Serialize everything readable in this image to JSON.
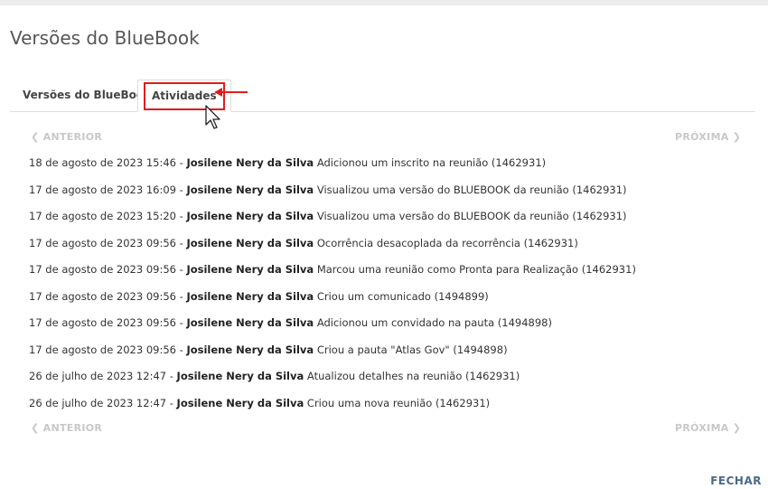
{
  "dialog": {
    "title": "Versões do BlueBook",
    "close_label": "FECHAR"
  },
  "tabs": [
    {
      "label": "Versões do BlueBook",
      "active": false
    },
    {
      "label": "Atividades",
      "active": true
    }
  ],
  "pager": {
    "prev_label": "ANTERIOR",
    "next_label": "PRÓXIMA"
  },
  "activities": [
    {
      "date": "18 de agosto de 2023 15:46 - ",
      "user": "Josilene Nery da Silva",
      "action": " Adicionou um inscrito na reunião (1462931)"
    },
    {
      "date": "17 de agosto de 2023 16:09 - ",
      "user": "Josilene Nery da Silva",
      "action": " Visualizou uma versão do BLUEBOOK da reunião (1462931)"
    },
    {
      "date": "17 de agosto de 2023 15:20 - ",
      "user": "Josilene Nery da Silva",
      "action": " Visualizou uma versão do BLUEBOOK da reunião (1462931)"
    },
    {
      "date": "17 de agosto de 2023 09:56 - ",
      "user": "Josilene Nery da Silva",
      "action": " Ocorrência desacoplada da recorrência (1462931)"
    },
    {
      "date": "17 de agosto de 2023 09:56 - ",
      "user": "Josilene Nery da Silva",
      "action": " Marcou uma reunião como Pronta para Realização (1462931)"
    },
    {
      "date": "17 de agosto de 2023 09:56 - ",
      "user": "Josilene Nery da Silva",
      "action": " Criou um comunicado (1494899)"
    },
    {
      "date": "17 de agosto de 2023 09:56 - ",
      "user": "Josilene Nery da Silva",
      "action": " Adicionou um convidado na pauta (1494898)"
    },
    {
      "date": "17 de agosto de 2023 09:56 - ",
      "user": "Josilene Nery da Silva",
      "action": " Criou a pauta \"Atlas Gov\" (1494898)"
    },
    {
      "date": "26 de julho de 2023 12:47 - ",
      "user": "Josilene Nery da Silva",
      "action": " Atualizou detalhes na reunião (1462931)"
    },
    {
      "date": "26 de julho de 2023 12:47 - ",
      "user": "Josilene Nery da Silva",
      "action": " Criou uma nova reunião (1462931)"
    }
  ],
  "colors": {
    "highlight": "#e21b1b",
    "pager_disabled": "#c8c8c8",
    "close_button": "#4a6a8a"
  },
  "icons": {
    "pointer": "mouse-pointer-icon",
    "annotation": "red-arrow-icon"
  }
}
